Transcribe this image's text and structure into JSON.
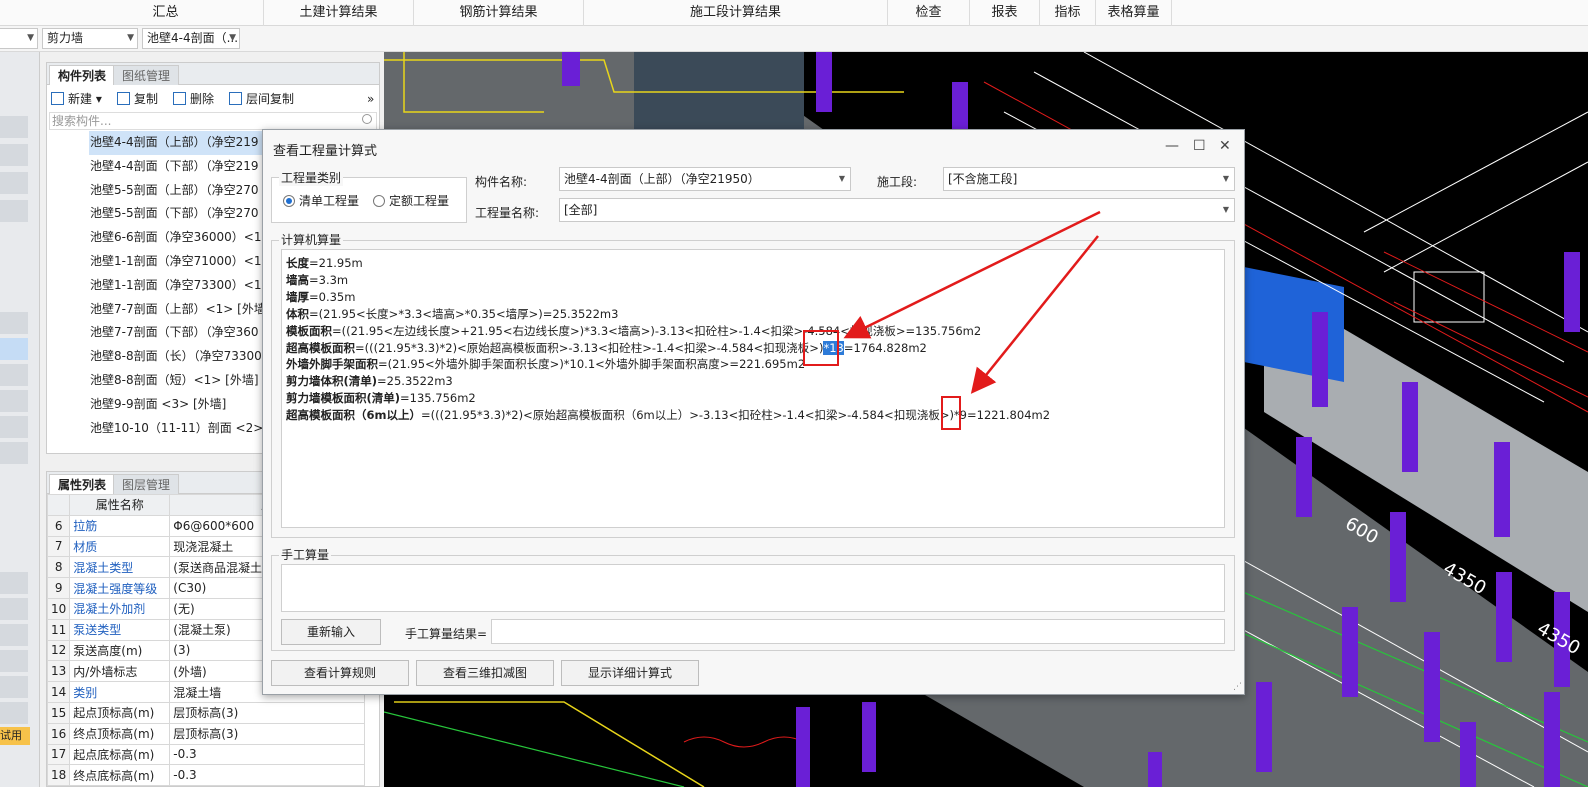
{
  "ribbon": {
    "items": [
      "汇总",
      "土建计算结果",
      "钢筋计算结果",
      "施工段计算结果",
      "检查",
      "报表",
      "指标",
      "表格算量"
    ]
  },
  "toolbar": {
    "type_combo": "剪力墙",
    "component_combo": "池壁4-4剖面（..."
  },
  "left_strip": {
    "trial_badge": "试用"
  },
  "component_panel": {
    "tabs": [
      "构件列表",
      "图纸管理"
    ],
    "tools": {
      "new": "新建",
      "copy": "复制",
      "delete": "删除",
      "floor_copy": "层间复制"
    },
    "search_placeholder": "搜索构件...",
    "items": [
      "池壁4-4剖面（上部）（净空219",
      "池壁4-4剖面（下部）（净空219",
      "池壁5-5剖面（上部）（净空270",
      "池壁5-5剖面（下部）（净空270",
      "池壁6-6剖面（净空36000）<1>",
      "池壁1-1剖面（净空71000）<1>",
      "池壁1-1剖面（净空73300）<1>",
      "池壁7-7剖面（上部）<1> [外墙",
      "池壁7-7剖面（下部）（净空360",
      "池壁8-8剖面（长）（净空73300",
      "池壁8-8剖面（短）<1> [外墙]",
      "池壁9-9剖面 <3> [外墙]",
      "池壁10-10（11-11）剖面 <2>"
    ]
  },
  "property_panel": {
    "tabs": [
      "属性列表",
      "图层管理"
    ],
    "headers": [
      "属性名称",
      "属"
    ],
    "rows": [
      {
        "n": "6",
        "k": "拉筋",
        "v": "Φ6@600*600",
        "blue": true
      },
      {
        "n": "7",
        "k": "材质",
        "v": "现浇混凝土",
        "blue": true
      },
      {
        "n": "8",
        "k": "混凝土类型",
        "v": "(泵送商品混凝土)",
        "blue": true
      },
      {
        "n": "9",
        "k": "混凝土强度等级",
        "v": "(C30)",
        "blue": true
      },
      {
        "n": "10",
        "k": "混凝土外加剂",
        "v": "(无)",
        "blue": true
      },
      {
        "n": "11",
        "k": "泵送类型",
        "v": "(混凝土泵)",
        "blue": true
      },
      {
        "n": "12",
        "k": "泵送高度(m)",
        "v": "(3)",
        "blue": false
      },
      {
        "n": "13",
        "k": "内/外墙标志",
        "v": "(外墙)",
        "blue": false
      },
      {
        "n": "14",
        "k": "类别",
        "v": "混凝土墙",
        "blue": true
      },
      {
        "n": "15",
        "k": "起点顶标高(m)",
        "v": "层顶标高(3)",
        "blue": false
      },
      {
        "n": "16",
        "k": "终点顶标高(m)",
        "v": "层顶标高(3)",
        "blue": false
      },
      {
        "n": "17",
        "k": "起点底标高(m)",
        "v": "-0.3",
        "blue": false
      },
      {
        "n": "18",
        "k": "终点底标高(m)",
        "v": "-0.3",
        "blue": false
      }
    ]
  },
  "cad": {
    "labels": [
      "4350",
      "4350",
      "600"
    ]
  },
  "dialog": {
    "title": "查看工程量计算式",
    "qty_type": {
      "legend": "工程量类别",
      "opt1": "清单工程量",
      "opt2": "定额工程量"
    },
    "component_name_label": "构件名称:",
    "component_name_value": "池壁4-4剖面（上部）（净空21950）",
    "stage_label": "施工段:",
    "stage_value": "[不含施工段]",
    "qty_name_label": "工程量名称:",
    "qty_name_value": "[全部]",
    "calc_legend": "计算机算量",
    "lines": [
      {
        "k": "长度",
        "v": "=21.95m"
      },
      {
        "k": "墙高",
        "v": "=3.3m"
      },
      {
        "k": "墙厚",
        "v": "=0.35m"
      },
      {
        "k": "体积",
        "v": "=(21.95<长度>*3.3<墙高>*0.35<墙厚>)=25.3522m3"
      },
      {
        "k": "模板面积",
        "v": "=((21.95<左边线长度>+21.95<右边线长度>)*3.3<墙高>)-3.13<扣砼柱>-1.4<扣梁>-4.584<扣现浇板>=135.756m2"
      },
      {
        "k": "超高模板面积",
        "v": "=(((21.95*3.3)*2)<原始超高模板面积>-3.13<扣砼柱>-1.4<扣梁>-4.584<扣现浇板>)",
        "hl": "*13",
        "tail": "=1764.828m2"
      },
      {
        "k": "外墙外脚手架面积",
        "v": "=(21.95<外墙外脚手架面积长度>)*10.1<外墙外脚手架面积高度>=221.695m2"
      },
      {
        "k": "剪力墙体积(清单)",
        "v": "=25.3522m3"
      },
      {
        "k": "剪力墙模板面积(清单)",
        "v": "=135.756m2"
      },
      {
        "k": "超高模板面积（6m以上）",
        "v": "=(((21.95*3.3)*2)<原始超高模板面积（6m以上）>-3.13<扣砼柱>-1.4<扣梁>-4.584<扣现浇板>)*9=1221.804m2"
      }
    ],
    "manual_legend": "手工算量",
    "reenter_button": "重新输入",
    "manual_result_label": "手工算量结果=",
    "btn_rules": "查看计算规则",
    "btn_3d": "查看三维扣减图",
    "btn_detail": "显示详细计算式"
  },
  "colors": {
    "accent": "#2d7bd8",
    "annotation": "#e21b1b",
    "cad_bg": "#000000",
    "column": "#6a1fd6"
  }
}
